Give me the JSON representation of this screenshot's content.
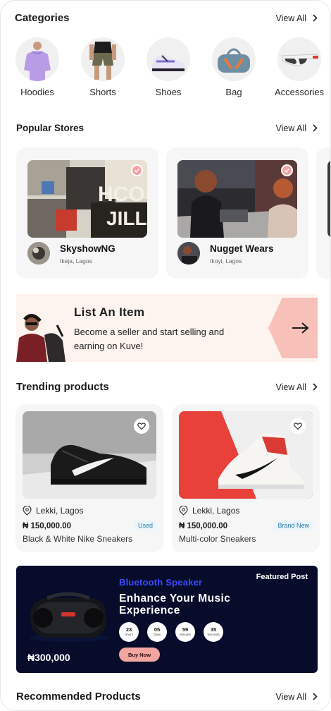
{
  "categories": {
    "title": "Categories",
    "view_all": "View All",
    "items": [
      {
        "label": "Hoodies"
      },
      {
        "label": "Shorts"
      },
      {
        "label": "Shoes"
      },
      {
        "label": "Bag"
      },
      {
        "label": "Accessories"
      }
    ]
  },
  "stores": {
    "title": "Popular Stores",
    "view_all": "View All",
    "items": [
      {
        "name": "SkyshowNG",
        "location": "Ikeja, Lagos"
      },
      {
        "name": "Nugget Wears",
        "location": "Ikoyi, Lagos"
      }
    ]
  },
  "list_item": {
    "title": "List An Item",
    "text": "Become a seller and start selling and earning on Kuve!"
  },
  "trending": {
    "title": "Trending products",
    "view_all": "View All",
    "items": [
      {
        "location": "Lekki, Lagos",
        "price": "₦ 150,000.00",
        "badge": "Used",
        "name": "Black & White Nike Sneakers"
      },
      {
        "location": "Lekki, Lagos",
        "price": "₦ 150,000.00",
        "badge": "Brand New",
        "name": "Multi-color Sneakers"
      }
    ]
  },
  "featured": {
    "tag": "Featured Post",
    "category": "Bluetooth Speaker",
    "title": "Enhance Your Music Experience",
    "price": "₦300,000",
    "buy_label": "Buy Now",
    "timer": [
      {
        "value": "23",
        "unit": "Hours"
      },
      {
        "value": "05",
        "unit": "Days"
      },
      {
        "value": "59",
        "unit": "Minutes"
      },
      {
        "value": "35",
        "unit": "Seconds"
      }
    ]
  },
  "recommended": {
    "title": "Recommended Products",
    "view_all": "View All"
  },
  "colors": {
    "accent_pink": "#f3a6a0",
    "featured_bg": "#060c2a",
    "featured_category": "#3d4bff",
    "card_bg": "#f6f6f6",
    "banner_bg": "#fdf4f0"
  }
}
